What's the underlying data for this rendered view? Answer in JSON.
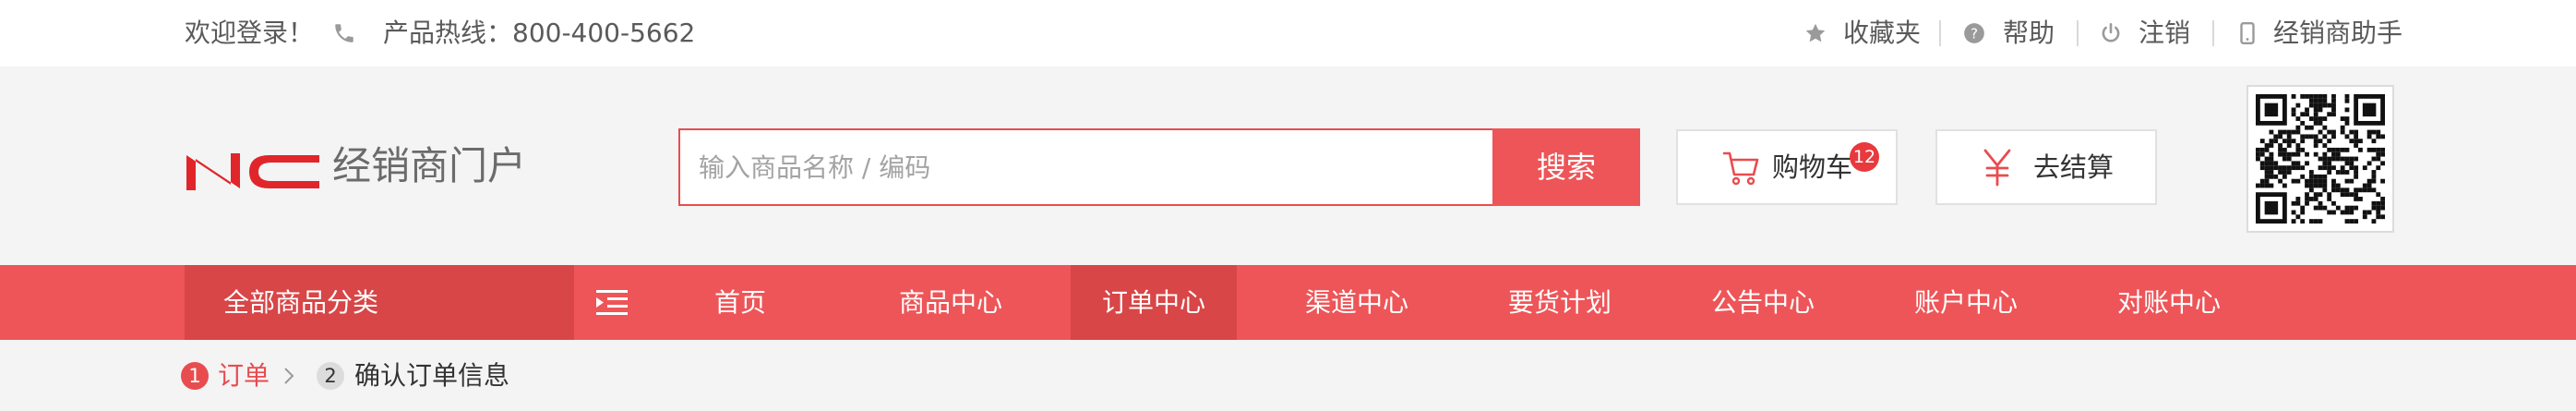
{
  "topbar": {
    "welcome": "欢迎登录！",
    "hotline_label": "产品热线：800-400-5662",
    "links": [
      "收藏夹",
      "帮助",
      "注销",
      "经销商助手"
    ]
  },
  "header": {
    "logo_mark": "NC",
    "logo_text": "经销商门户",
    "search_placeholder": "输入商品名称 / 编码",
    "search_button": "搜索",
    "cart_label": "购物车",
    "cart_count": "12",
    "checkout_label": "去结算"
  },
  "nav": {
    "all_categories": "全部商品分类",
    "items": [
      "首页",
      "商品中心",
      "订单中心",
      "渠道中心",
      "要货计划",
      "公告中心",
      "账户中心",
      "对账中心"
    ],
    "active_index": 2
  },
  "steps": [
    {
      "num": "1",
      "label": "订单"
    },
    {
      "num": "2",
      "label": "确认订单信息"
    }
  ],
  "colors": {
    "brand_red": "#ee5558",
    "brand_dark_red": "#d84647",
    "badge_red": "#e8393d"
  }
}
